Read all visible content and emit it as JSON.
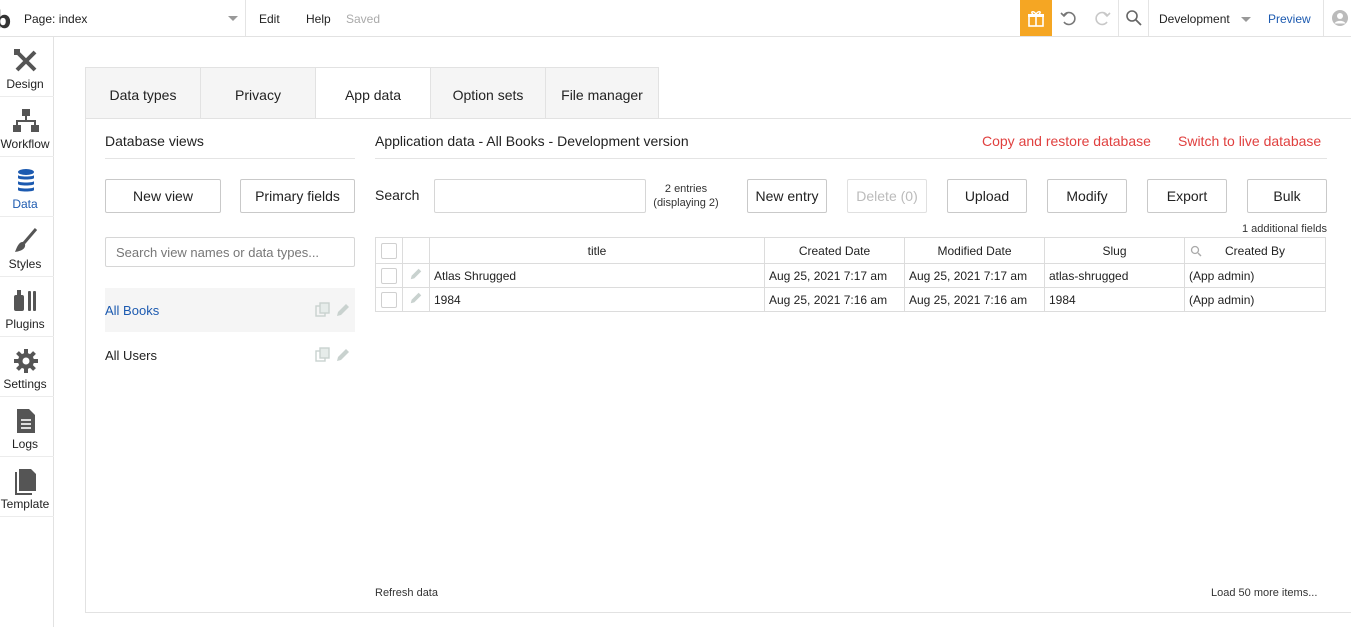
{
  "topbar": {
    "logo": "b",
    "page_select": "Page: index",
    "menu_edit": "Edit",
    "menu_help": "Help",
    "saved": "Saved",
    "environment": "Development",
    "preview": "Preview",
    "accent_color": "#f5a623",
    "link_color": "#1c5ab0"
  },
  "sidebar": {
    "items": [
      {
        "label": "Design",
        "icon": "design-icon"
      },
      {
        "label": "Workflow",
        "icon": "workflow-icon"
      },
      {
        "label": "Data",
        "icon": "database-icon"
      },
      {
        "label": "Styles",
        "icon": "brush-icon"
      },
      {
        "label": "Plugins",
        "icon": "plug-icon"
      },
      {
        "label": "Settings",
        "icon": "gear-icon"
      },
      {
        "label": "Logs",
        "icon": "document-icon"
      },
      {
        "label": "Template",
        "icon": "template-icon"
      }
    ],
    "active": "Data"
  },
  "tabs": [
    {
      "label": "Data types"
    },
    {
      "label": "Privacy"
    },
    {
      "label": "App data"
    },
    {
      "label": "Option sets"
    },
    {
      "label": "File manager"
    }
  ],
  "left_panel": {
    "title": "Database views",
    "new_view": "New view",
    "primary_fields": "Primary fields",
    "search_placeholder": "Search view names or data types...",
    "views": [
      {
        "label": "All Books",
        "active": true
      },
      {
        "label": "All Users",
        "active": false
      }
    ]
  },
  "main": {
    "title": "Application data - All Books - Development version",
    "copy_restore": "Copy and restore database",
    "switch_live": "Switch to live database",
    "search_label": "Search",
    "entries_line1": "2 entries",
    "entries_line2": "(displaying 2)",
    "buttons": {
      "new_entry": "New entry",
      "delete": "Delete (0)",
      "upload": "Upload",
      "modify": "Modify",
      "export": "Export",
      "bulk": "Bulk"
    },
    "additional_fields": "1 additional fields",
    "table": {
      "headers": [
        "title",
        "Created Date",
        "Modified Date",
        "Slug",
        "Created By"
      ],
      "rows": [
        [
          "Atlas Shrugged",
          "Aug 25, 2021 7:17 am",
          "Aug 25, 2021 7:17 am",
          "atlas-shrugged",
          "(App admin)"
        ],
        [
          "1984",
          "Aug 25, 2021 7:16 am",
          "Aug 25, 2021 7:16 am",
          "1984",
          "(App admin)"
        ]
      ]
    },
    "refresh": "Refresh data",
    "load_more": "Load 50 more items..."
  }
}
